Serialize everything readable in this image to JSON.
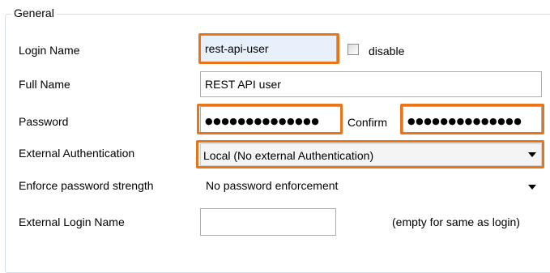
{
  "group": {
    "title": "General"
  },
  "login_name": {
    "label": "Login Name",
    "value": "rest-api-user",
    "disable_label": "disable",
    "disable_checked": false
  },
  "full_name": {
    "label": "Full Name",
    "value": "REST API user"
  },
  "password": {
    "label": "Password",
    "value": "●●●●●●●●●●●●●●",
    "confirm_label": "Confirm",
    "confirm_value": "●●●●●●●●●●●●●●"
  },
  "external_auth": {
    "label": "External Authentication",
    "value": "Local (No external Authentication)",
    "icon": "chevron-down-icon"
  },
  "password_strength": {
    "label": "Enforce password strength",
    "value": "No password enforcement",
    "icon": "chevron-down-icon"
  },
  "external_login": {
    "label": "External Login Name",
    "value": "",
    "hint": "(empty for same as login)"
  },
  "colors": {
    "highlight": "#e8751a",
    "field_border": "#abadb3",
    "group_border": "#d5dfe5",
    "focused_field_bg": "#e8f1fb"
  }
}
